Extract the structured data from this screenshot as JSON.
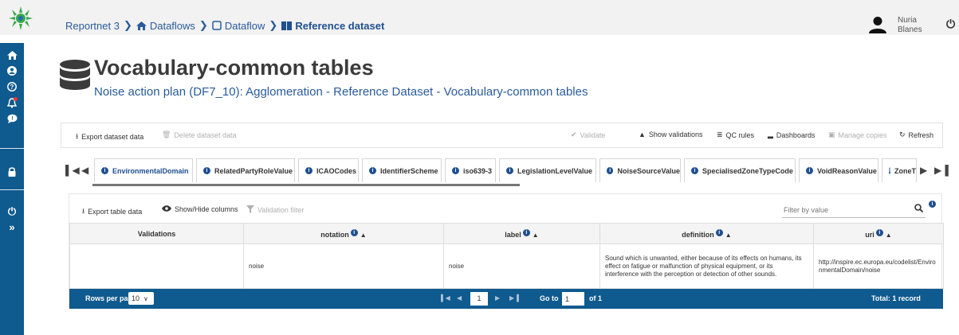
{
  "header": {
    "breadcrumb": [
      {
        "label": "Reportnet 3",
        "icon": "none"
      },
      {
        "label": "Dataflows",
        "icon": "home-icon"
      },
      {
        "label": "Dataflow",
        "icon": "clone-icon"
      },
      {
        "label": "Reference dataset",
        "icon": "book-icon"
      }
    ],
    "user": {
      "first_name": "Nuria",
      "last_name": "Blanes"
    }
  },
  "sidebar": {
    "icons": [
      "home-icon",
      "user-circle-icon",
      "help-icon",
      "bell-icon",
      "comment-icon",
      "lock-icon",
      "power-icon",
      "expand-icon"
    ]
  },
  "page": {
    "title": "Vocabulary-common tables",
    "subtitle": "Noise action plan (DF7_10): Agglomeration - Reference Dataset - Vocabulary-common tables"
  },
  "dataset_toolbar": {
    "export": "Export dataset data",
    "delete": "Delete dataset data",
    "validate": "Validate",
    "show_validations": "Show validations",
    "qc_rules": "QC rules",
    "dashboards": "Dashboards",
    "manage_copies": "Manage copies",
    "refresh": "Refresh"
  },
  "tabs": [
    {
      "label": "EnvironmentalDomain",
      "active": true
    },
    {
      "label": "RelatedPartyRoleValue"
    },
    {
      "label": "ICAOCodes"
    },
    {
      "label": "IdentifierScheme"
    },
    {
      "label": "iso639-3"
    },
    {
      "label": "LegislationLevelValue"
    },
    {
      "label": "NoiseSourceValue"
    },
    {
      "label": "SpecialisedZoneTypeCode"
    },
    {
      "label": "VoidReasonValue"
    },
    {
      "label": "ZoneT"
    }
  ],
  "table_toolbar": {
    "export": "Export table data",
    "show_hide": "Show/Hide columns",
    "validation_filter": "Validation filter",
    "filter_placeholder": "Filter by value"
  },
  "table": {
    "columns": [
      "Validations",
      "notation",
      "label",
      "definition",
      "uri"
    ],
    "rows": [
      {
        "validations": "",
        "notation": "noise",
        "label": "noise",
        "definition": "Sound which is unwanted, either because of its effects on humans, its effect on fatigue or malfunction of physical equipment, or its interference with the perception or detection of other sounds.",
        "uri": "http://inspire.ec.europa.eu/codelist/EnvironmentalDomain/noise"
      }
    ]
  },
  "paginator": {
    "rows_per_page_label": "Rows per page",
    "rows_per_page": "10",
    "current_page": "1",
    "goto_label": "Go to",
    "goto_value": "1",
    "of_label": "of 1",
    "total": "Total: 1 record"
  },
  "colors": {
    "primary": "#0f5a8e",
    "link": "#2a5b9a",
    "title": "#3b3b3b"
  }
}
